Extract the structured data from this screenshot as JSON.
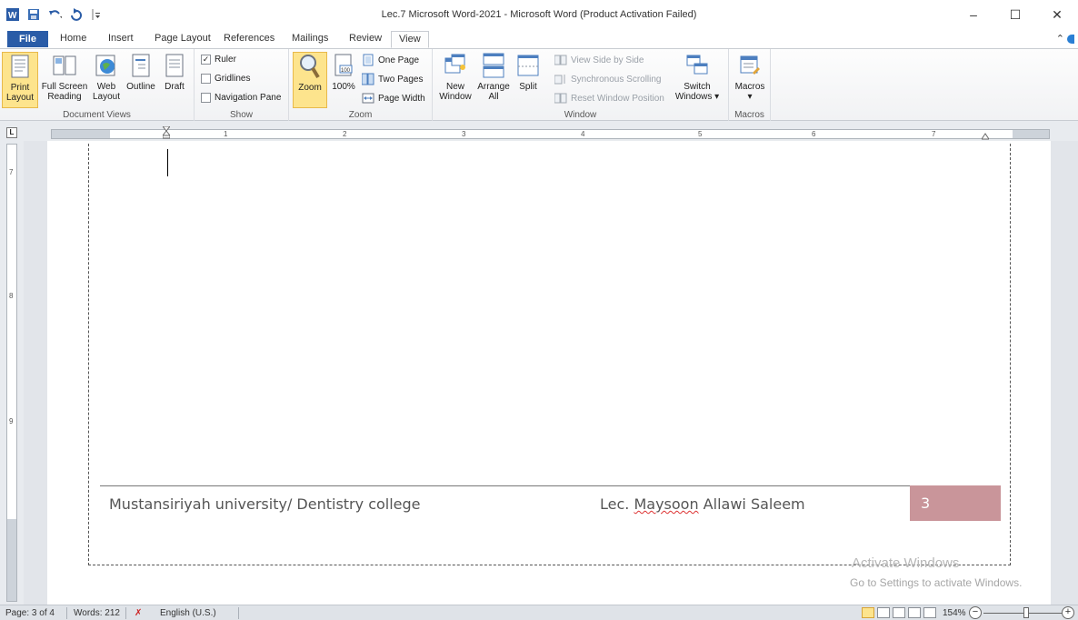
{
  "window": {
    "title": "Lec.7 Microsoft Word-2021  -  Microsoft Word (Product Activation Failed)"
  },
  "quick_access": [
    "word-logo-icon",
    "save-icon",
    "undo-icon",
    "redo-icon",
    "customize-qat-icon"
  ],
  "tabs": [
    {
      "label": "File"
    },
    {
      "label": "Home"
    },
    {
      "label": "Insert"
    },
    {
      "label": "Page Layout"
    },
    {
      "label": "References"
    },
    {
      "label": "Mailings"
    },
    {
      "label": "Review"
    },
    {
      "label": "View"
    }
  ],
  "ribbon": {
    "document_views": {
      "label": "Document Views",
      "print_layout": [
        "Print",
        "Layout"
      ],
      "full_screen": [
        "Full Screen",
        "Reading"
      ],
      "web_layout": [
        "Web",
        "Layout"
      ],
      "outline": "Outline",
      "draft": "Draft"
    },
    "show": {
      "label": "Show",
      "ruler": "Ruler",
      "ruler_checked": "✓",
      "gridlines": "Gridlines",
      "navigation_pane": "Navigation Pane"
    },
    "zoom": {
      "label": "Zoom",
      "zoom": "Zoom",
      "hundred": "100%",
      "hundred_icon_text": "100",
      "one_page": "One Page",
      "two_pages": "Two Pages",
      "page_width": "Page Width"
    },
    "window": {
      "label": "Window",
      "new_window": [
        "New",
        "Window"
      ],
      "arrange_all": [
        "Arrange",
        "All"
      ],
      "split": "Split",
      "view_side_by_side": "View Side by Side",
      "sync_scrolling": "Synchronous Scrolling",
      "reset_position": "Reset Window Position",
      "switch_windows": [
        "Switch",
        "Windows ▾"
      ]
    },
    "macros": {
      "label": "Macros",
      "macros": "Macros",
      "arrow": "▾"
    }
  },
  "ruler": {
    "corner": "L",
    "numbers": [
      "1",
      "2",
      "3",
      "4",
      "5",
      "6",
      "7"
    ],
    "vertical_numbers": [
      "7",
      "8",
      "9"
    ]
  },
  "document": {
    "footer_left": "Mustansiriyah university/ Dentistry college",
    "footer_mid_prefix": "Lec. ",
    "footer_mid_misspelled": "Maysoon",
    "footer_mid_suffix": " Allawi Saleem",
    "page_number": "3"
  },
  "watermark": {
    "line1": "Activate Windows",
    "line2": "Go to Settings to activate Windows."
  },
  "status": {
    "page": "Page: 3 of 4",
    "words": "Words: 212",
    "language": "English (U.S.)",
    "zoom": "154%"
  },
  "colors": {
    "file_tab": "#2a5ca7",
    "selected_button": "#fde48d",
    "page_number_box": "#c9959a"
  }
}
